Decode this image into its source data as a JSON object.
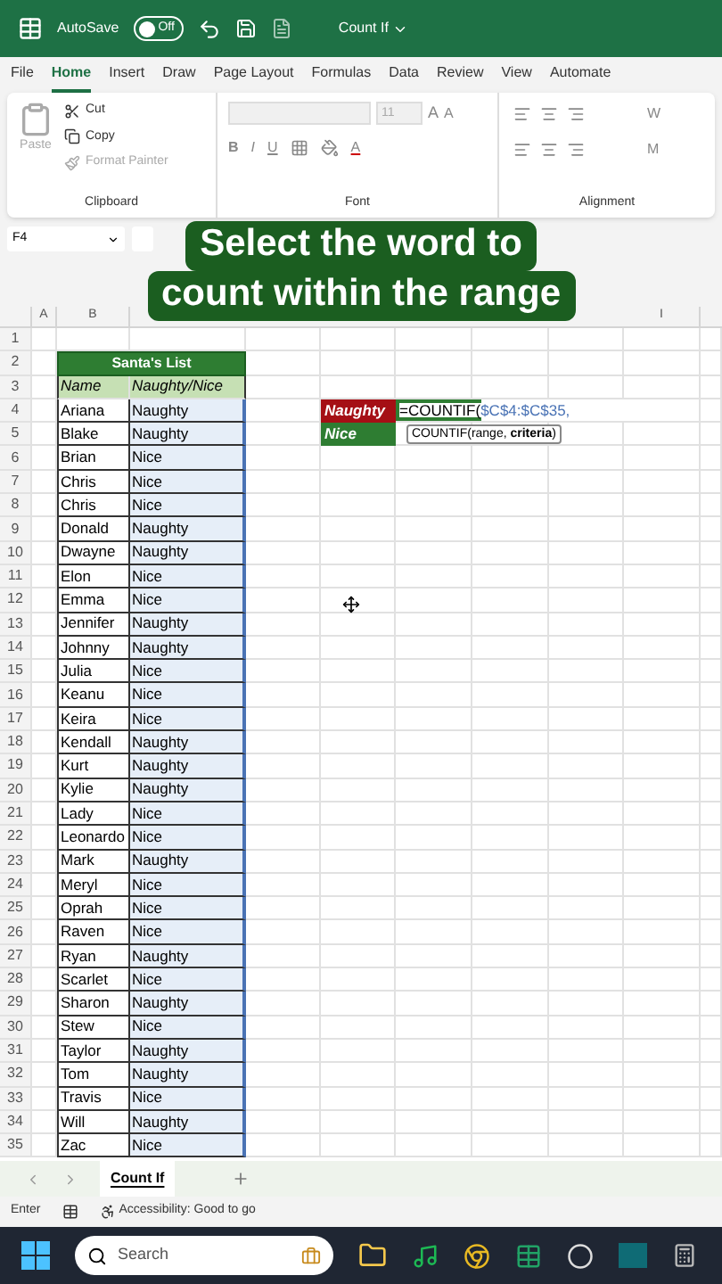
{
  "title_bar": {
    "autosave_label": "AutoSave",
    "autosave": {
      "on": false,
      "label": "Off"
    },
    "document": "Count If"
  },
  "menu_tabs": [
    {
      "label": "File",
      "selected": false
    },
    {
      "label": "Home",
      "selected": true
    },
    {
      "label": "Insert",
      "selected": false
    },
    {
      "label": "Draw",
      "selected": false
    },
    {
      "label": "Page Layout",
      "selected": false
    },
    {
      "label": "Formulas",
      "selected": false
    },
    {
      "label": "Data",
      "selected": false
    },
    {
      "label": "Review",
      "selected": false
    },
    {
      "label": "View",
      "selected": false
    },
    {
      "label": "Automate",
      "selected": false
    }
  ],
  "ribbon": {
    "clipboard": {
      "paste": "Paste",
      "cut": "Cut",
      "copy": "Copy",
      "format_painter": "Format Painter",
      "label": "Clipboard"
    },
    "font": {
      "size": "11",
      "grow": "A",
      "shrink": "A",
      "bold": "B",
      "italic": "I",
      "underline": "U",
      "font_color": "A",
      "label": "Font"
    },
    "alignment": {
      "label": "Alignment",
      "wrap": "W",
      "merge": "M"
    }
  },
  "name_box": "F4",
  "caption": [
    "Select the word to",
    "count within the range"
  ],
  "columns": [
    {
      "label": "A"
    },
    {
      "label": "B"
    },
    {},
    {},
    {},
    {},
    {},
    {},
    {
      "label": "I"
    },
    {}
  ],
  "sheet": {
    "reference_highlight": true,
    "rows": [
      {
        "n": "1",
        "kind": "blank"
      },
      {
        "n": "2",
        "kind": "title",
        "text": "Santa's List"
      },
      {
        "n": "3",
        "kind": "header",
        "name": "Name",
        "status": "Naughty/Nice"
      },
      {
        "n": "4",
        "kind": "entry",
        "name": "Ariana",
        "status": "Naughty",
        "label": {
          "text": "Naughty",
          "color": "#a50f15"
        },
        "formula": {
          "start": "=COUNTIF(",
          "ref": "$C$4:$C$35,"
        }
      },
      {
        "n": "5",
        "kind": "entry",
        "name": "Blake",
        "status": "Naughty",
        "label": {
          "text": "Nice",
          "color": "#2e7d32"
        },
        "tooltip": "COUNTIF(range, **criteria**)"
      },
      {
        "n": "6",
        "kind": "entry",
        "name": "Brian",
        "status": "Nice"
      },
      {
        "n": "7",
        "kind": "entry",
        "name": "Chris",
        "status": "Nice"
      },
      {
        "n": "8",
        "kind": "entry",
        "name": "Chris",
        "status": "Nice"
      },
      {
        "n": "9",
        "kind": "entry",
        "name": "Donald",
        "status": "Naughty"
      },
      {
        "n": "10",
        "kind": "entry",
        "name": "Dwayne",
        "status": "Naughty"
      },
      {
        "n": "11",
        "kind": "entry",
        "name": "Elon",
        "status": "Nice"
      },
      {
        "n": "12",
        "kind": "entry",
        "name": "Emma",
        "status": "Nice"
      },
      {
        "n": "13",
        "kind": "entry",
        "name": "Jennifer",
        "status": "Naughty"
      },
      {
        "n": "14",
        "kind": "entry",
        "name": "Johnny",
        "status": "Naughty"
      },
      {
        "n": "15",
        "kind": "entry",
        "name": "Julia",
        "status": "Nice"
      },
      {
        "n": "16",
        "kind": "entry",
        "name": "Keanu",
        "status": "Nice"
      },
      {
        "n": "17",
        "kind": "entry",
        "name": "Keira",
        "status": "Nice"
      },
      {
        "n": "18",
        "kind": "entry",
        "name": "Kendall",
        "status": "Naughty"
      },
      {
        "n": "19",
        "kind": "entry",
        "name": "Kurt",
        "status": "Naughty"
      },
      {
        "n": "20",
        "kind": "entry",
        "name": "Kylie",
        "status": "Naughty"
      },
      {
        "n": "21",
        "kind": "entry",
        "name": "Lady",
        "status": "Nice"
      },
      {
        "n": "22",
        "kind": "entry",
        "name": "Leonardo",
        "status": "Nice"
      },
      {
        "n": "23",
        "kind": "entry",
        "name": "Mark",
        "status": "Naughty"
      },
      {
        "n": "24",
        "kind": "entry",
        "name": "Meryl",
        "status": "Nice"
      },
      {
        "n": "25",
        "kind": "entry",
        "name": "Oprah",
        "status": "Nice"
      },
      {
        "n": "26",
        "kind": "entry",
        "name": "Raven",
        "status": "Nice"
      },
      {
        "n": "27",
        "kind": "entry",
        "name": "Ryan",
        "status": "Naughty"
      },
      {
        "n": "28",
        "kind": "entry",
        "name": "Scarlet",
        "status": "Nice"
      },
      {
        "n": "29",
        "kind": "entry",
        "name": "Sharon",
        "status": "Naughty"
      },
      {
        "n": "30",
        "kind": "entry",
        "name": "Stew",
        "status": "Nice"
      },
      {
        "n": "31",
        "kind": "entry",
        "name": "Taylor",
        "status": "Naughty"
      },
      {
        "n": "32",
        "kind": "entry",
        "name": "Tom",
        "status": "Naughty"
      },
      {
        "n": "33",
        "kind": "entry",
        "name": "Travis",
        "status": "Nice"
      },
      {
        "n": "34",
        "kind": "entry",
        "name": "Will",
        "status": "Naughty"
      },
      {
        "n": "35",
        "kind": "entry",
        "name": "Zac",
        "status": "Nice"
      }
    ]
  },
  "sheet_tabs": [
    {
      "label": "Count If",
      "selected": true
    }
  ],
  "status_bar": {
    "mode": "Enter",
    "accessibility": "Accessibility: Good to go"
  },
  "taskbar": {
    "search_placeholder": "Search"
  }
}
